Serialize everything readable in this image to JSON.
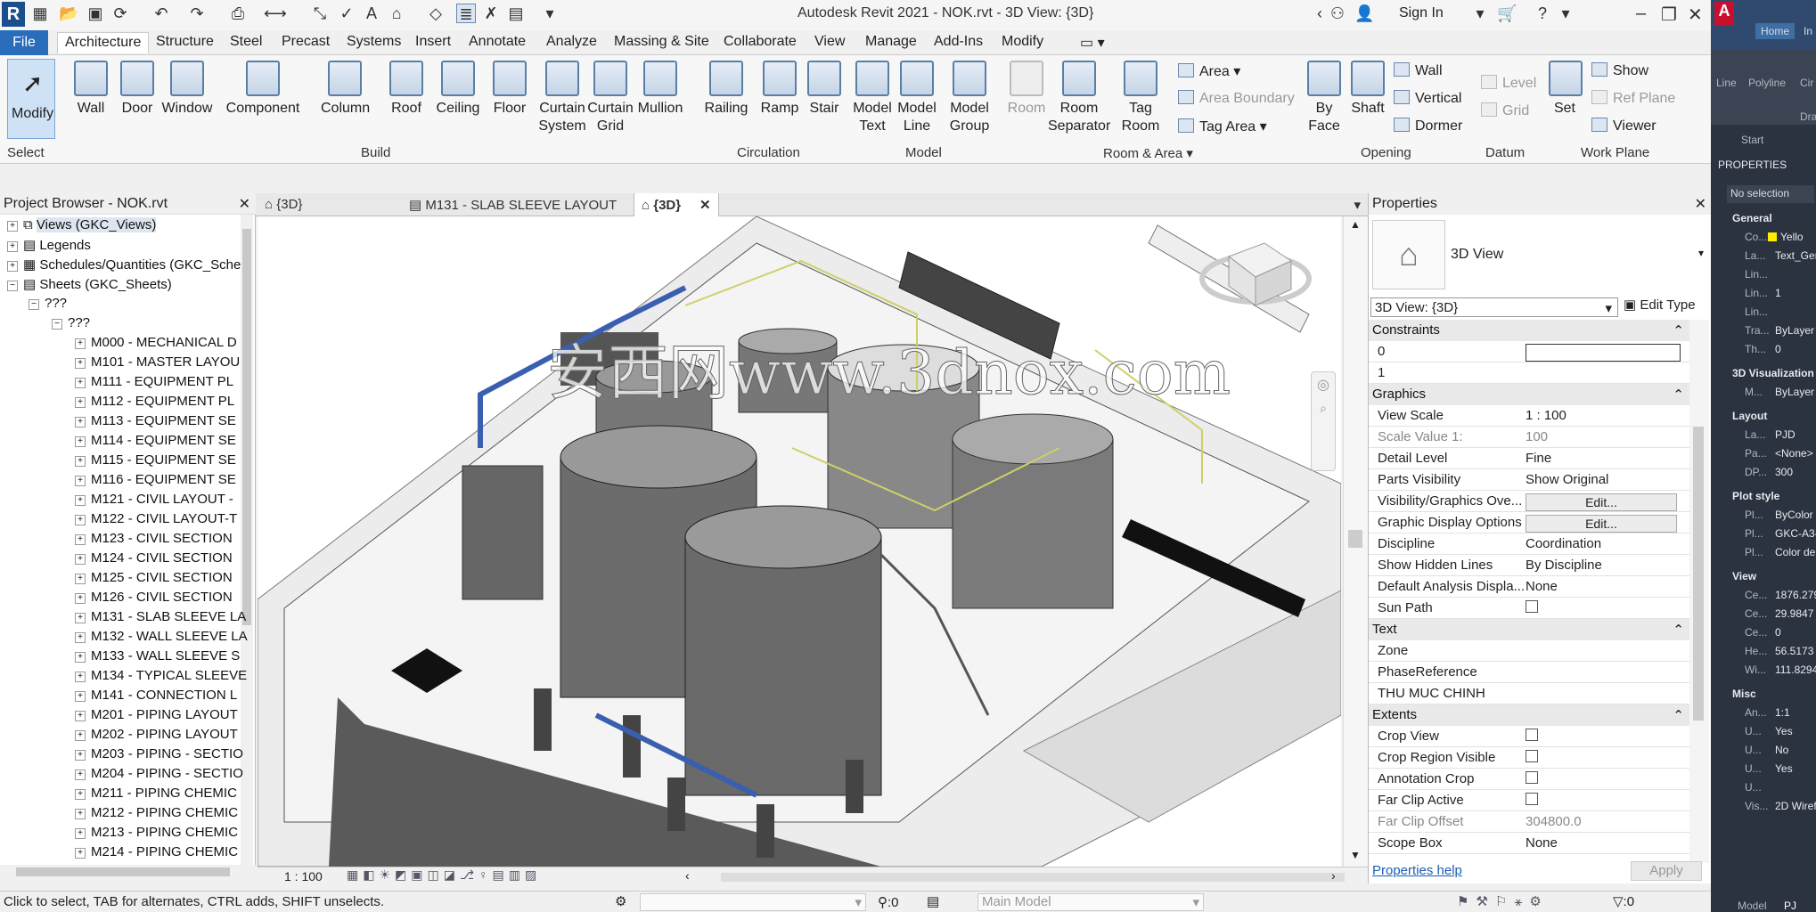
{
  "window": {
    "title": "Autodesk Revit 2021 - NOK.rvt - 3D View: {3D}",
    "sign_in": "Sign In"
  },
  "menu_tabs": [
    "File",
    "Architecture",
    "Structure",
    "Steel",
    "Precast",
    "Systems",
    "Insert",
    "Annotate",
    "Analyze",
    "Massing & Site",
    "Collaborate",
    "View",
    "Manage",
    "Add-Ins",
    "Modify"
  ],
  "ribbon": {
    "modify": "Modify",
    "select": "Select",
    "build": [
      "Wall",
      "Door",
      "Window",
      "Component",
      "Column",
      "Roof",
      "Ceiling",
      "Floor",
      "Curtain System",
      "Curtain Grid",
      "Mullion"
    ],
    "circulation": [
      "Railing",
      "Ramp",
      "Stair"
    ],
    "model": [
      "Model Text",
      "Model Line",
      "Model Group"
    ],
    "room": [
      "Room",
      "Room Separator",
      "Tag Room"
    ],
    "area_small": [
      "Area",
      "Area  Boundary",
      "Tag  Area"
    ],
    "opening": [
      "By Face",
      "Shaft"
    ],
    "opening_small": [
      "Wall",
      "Vertical",
      "Dormer"
    ],
    "datum": [
      "Level",
      "Grid"
    ],
    "workplane": [
      "Set"
    ],
    "workplane_small": [
      "Show",
      "Ref  Plane",
      "Viewer"
    ],
    "panels": [
      "Build",
      "Circulation",
      "Model",
      "Room & Area",
      "Opening",
      "Datum",
      "Work Plane"
    ]
  },
  "project_browser": {
    "title": "Project Browser - NOK.rvt",
    "top": [
      "Views (GKC_Views)",
      "Legends",
      "Schedules/Quantities (GKC_Sche",
      "Sheets (GKC_Sheets)"
    ],
    "level1": "???",
    "level2": "???",
    "sheets": [
      "M000 - MECHANICAL D",
      "M101 - MASTER LAYOU",
      "M111 - EQUIPMENT PL",
      "M112 - EQUIPMENT PL",
      "M113 - EQUIPMENT SE",
      "M114 - EQUIPMENT SE",
      "M115 - EQUIPMENT SE",
      "M116 - EQUIPMENT SE",
      "M121 - CIVIL LAYOUT -",
      "M122 - CIVIL LAYOUT-T",
      "M123 - CIVIL SECTION",
      "M124 - CIVIL SECTION",
      "M125 - CIVIL SECTION",
      "M126 - CIVIL SECTION",
      "M131 - SLAB SLEEVE LA",
      "M132 - WALL SLEEVE LA",
      "M133 - WALL SLEEVE S",
      "M134 - TYPICAL SLEEVE",
      "M141 - CONNECTION L",
      "M201 - PIPING LAYOUT",
      "M202 - PIPING LAYOUT",
      "M203 - PIPING - SECTIO",
      "M204 - PIPING - SECTIO",
      "M211 - PIPING CHEMIC",
      "M212 - PIPING CHEMIC",
      "M213 - PIPING CHEMIC",
      "M214 - PIPING CHEMIC"
    ]
  },
  "view_tabs": [
    "{3D}",
    "M131 - SLAB SLEEVE LAYOUT",
    "{3D}"
  ],
  "watermark": "安西网www.3dnox.com",
  "view_scale_bar": "1 : 100",
  "properties": {
    "title": "Properties",
    "type": "3D View",
    "instance": "3D View: {3D}",
    "edit_type": "Edit Type",
    "sections": {
      "constraints": "Constraints",
      "graphics": "Graphics",
      "text": "Text",
      "extents": "Extents"
    },
    "constraints_rows": [
      [
        "0",
        ""
      ],
      [
        "1",
        ""
      ]
    ],
    "graphics_rows": [
      [
        "View Scale",
        "1 : 100"
      ],
      [
        "Scale Value    1:",
        "100"
      ],
      [
        "Detail Level",
        "Fine"
      ],
      [
        "Parts Visibility",
        "Show Original"
      ],
      [
        "Visibility/Graphics Ove...",
        "Edit..."
      ],
      [
        "Graphic Display Options",
        "Edit..."
      ],
      [
        "Discipline",
        "Coordination"
      ],
      [
        "Show Hidden Lines",
        "By Discipline"
      ],
      [
        "Default Analysis Displa...",
        "None"
      ],
      [
        "Sun Path",
        ""
      ]
    ],
    "text_rows": [
      [
        "Zone",
        ""
      ],
      [
        "PhaseReference",
        ""
      ],
      [
        "THU MUC CHINH",
        ""
      ]
    ],
    "extents_rows": [
      [
        "Crop View",
        ""
      ],
      [
        "Crop Region Visible",
        ""
      ],
      [
        "Annotation Crop",
        ""
      ],
      [
        "Far Clip Active",
        ""
      ],
      [
        "Far Clip Offset",
        "304800.0"
      ],
      [
        "Scope Box",
        "None"
      ]
    ],
    "help": "Properties help",
    "apply": "Apply"
  },
  "status": {
    "hint": "Click to select, TAB for alternates, CTRL adds, SHIFT unselects.",
    "count": ":0",
    "model": "Main Model",
    "filter": ":0"
  },
  "acad": {
    "tabs": [
      "Home",
      "In"
    ],
    "tools": [
      "Line",
      "Polyline",
      "Cir"
    ],
    "draw": "Draw",
    "start": "Start",
    "props": "PROPERTIES",
    "selection": "No selection",
    "general": "General",
    "general_rows": [
      [
        "Co...",
        "Yello"
      ],
      [
        "La...",
        "Text_Gen"
      ],
      [
        "Lin...",
        ""
      ],
      [
        "Lin...",
        "1"
      ],
      [
        "Lin...",
        ""
      ],
      [
        "Tra...",
        "ByLayer"
      ],
      [
        "Th...",
        "0"
      ]
    ],
    "viz": "3D Visualization",
    "viz_rows": [
      [
        "M...",
        "ByLayer"
      ]
    ],
    "layout": "Layout",
    "layout_rows": [
      [
        "La...",
        "PJD"
      ],
      [
        "Pa...",
        "<None>"
      ],
      [
        "DP...",
        "300"
      ]
    ],
    "plot": "Plot style",
    "plot_rows": [
      [
        "Pl...",
        "ByColor"
      ],
      [
        "Pl...",
        "GKC-A3-"
      ],
      [
        "Pl...",
        "Color de"
      ]
    ],
    "view": "View",
    "view_rows": [
      [
        "Ce...",
        "1876.279"
      ],
      [
        "Ce...",
        "29.9847"
      ],
      [
        "Ce...",
        "0"
      ],
      [
        "He...",
        "56.5173"
      ],
      [
        "Wi...",
        "111.8294"
      ]
    ],
    "misc": "Misc",
    "misc_rows": [
      [
        "An...",
        "1:1"
      ],
      [
        "U...",
        "Yes"
      ],
      [
        "U...",
        "No"
      ],
      [
        "U...",
        "Yes"
      ],
      [
        "U...",
        ""
      ],
      [
        "Vis...",
        "2D Wiref"
      ]
    ],
    "bottom": [
      "Model",
      "PJ"
    ]
  },
  "colors": {
    "accent": "#2a6ebb",
    "acad_bg": "#2b3340",
    "swatch_yellow": "#ffea00"
  }
}
